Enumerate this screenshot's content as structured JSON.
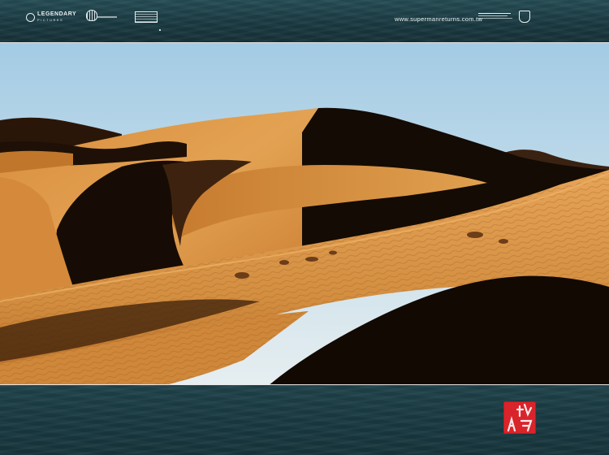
{
  "header": {
    "url_text": "www.supermanreturns.com.tw",
    "logos": [
      "legendary-logo",
      "shell-logo",
      "box-logo",
      "warner-bros-shield-logo"
    ]
  },
  "photo": {
    "subject": "sand-dunes",
    "colors": {
      "sky_top": "#a9cfe6",
      "sky_bottom": "#e7eef0",
      "sand_light": "#e2a04f",
      "sand_mid": "#c87d32",
      "shadow": "#140b04"
    }
  },
  "footer": {
    "seal_icon": "red-seal-stamp",
    "seal_color": "#d9242b",
    "water_color": "#1b3a42"
  }
}
